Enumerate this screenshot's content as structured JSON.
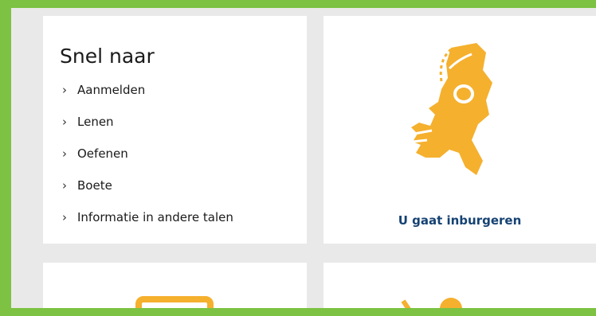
{
  "quick_links": {
    "title": "Snel naar",
    "items": [
      {
        "label": "Aanmelden"
      },
      {
        "label": "Lenen"
      },
      {
        "label": "Oefenen"
      },
      {
        "label": "Boete"
      },
      {
        "label": "Informatie in andere talen"
      }
    ]
  },
  "map_card": {
    "link_label": "U gaat inburgeren",
    "icon": "netherlands-map-icon"
  },
  "colors": {
    "frame_green": "#7dc242",
    "icon_orange": "#f5b02e",
    "link_blue": "#154273",
    "background_gray": "#e9e9e9"
  }
}
